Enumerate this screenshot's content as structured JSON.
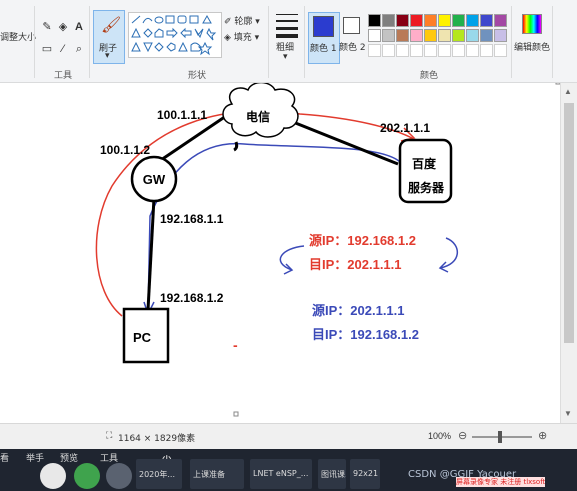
{
  "ribbon": {
    "resize_label": "调整大小",
    "tools_label": "工具",
    "brush_label": "刷子",
    "shapes_label": "形状",
    "outline_label": "轮廓",
    "fill_label": "填充",
    "size_label": "粗细",
    "color1_label": "颜色 1",
    "color2_label": "颜色 2",
    "colors_label": "颜色",
    "edit_colors_label": "编辑颜色",
    "text_tool_glyph": "A",
    "color1_value": "#2b3ccf",
    "color2_value": "#ffffff",
    "palette_row1": [
      "#000000",
      "#7f7f7f",
      "#880015",
      "#ed1c24",
      "#ff7f27",
      "#fff200",
      "#22b14c",
      "#00a2e8",
      "#3f48cc",
      "#a349a4"
    ],
    "palette_row2": [
      "#ffffff",
      "#c3c3c3",
      "#b97a57",
      "#ffaec9",
      "#ffc90e",
      "#efe4b0",
      "#b5e61d",
      "#99d9ea",
      "#7092be",
      "#c8bfe7"
    ]
  },
  "diagram": {
    "cloud_label": "电信",
    "cloud_ip": "100.1.1.1",
    "gw_label": "GW",
    "gw_ip_top": "100.1.1.2",
    "gw_ip_bottom": "192.168.1.1",
    "server_label_line1": "百度",
    "server_label_line2": "服务器",
    "server_ip": "202.1.1.1",
    "pc_label": "PC",
    "pc_ip": "192.168.1.2",
    "red_src": "源IP：192.168.1.2",
    "red_dst": "目IP：202.1.1.1",
    "blue_src": "源IP：202.1.1.1",
    "blue_dst": "目IP：192.168.1.2",
    "dash_mark": "-",
    "red_color": "#e23b2e",
    "blue_color": "#3b4ab8"
  },
  "statusbar": {
    "dimensions": "1164 × 1829像素",
    "zoom": "100%"
  },
  "taskbar": {
    "menu_items": [
      "看",
      "举手",
      "预览",
      "工具"
    ],
    "buttons": [
      "2020年...",
      "上课准备",
      "LNET eNSP_...",
      "图讯课...",
      "92x21"
    ],
    "watermark": "CSDN @GGIF Yacouer",
    "banner": "屏幕录像专家 未注册 tlxsoft"
  }
}
